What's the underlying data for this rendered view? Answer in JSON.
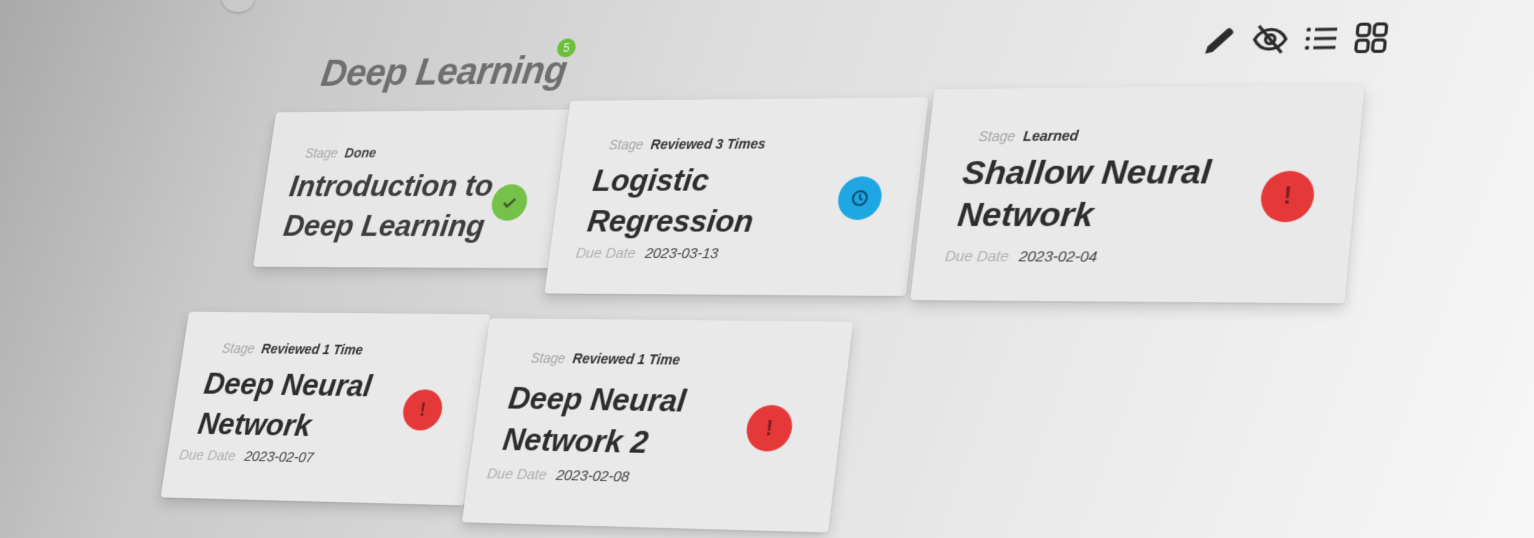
{
  "header": {
    "title": "Deep Learning",
    "count": "5"
  },
  "toolbar": {
    "items": [
      {
        "icon": "pencil-icon"
      },
      {
        "icon": "eye-off-icon"
      },
      {
        "icon": "list-view-icon"
      },
      {
        "icon": "grid-view-icon"
      }
    ]
  },
  "labels": {
    "stage": "Stage",
    "due_date": "Due Date"
  },
  "cards": [
    {
      "title": "Introduction to Deep Learning",
      "stage": "Done",
      "due_date": "",
      "status": "done",
      "status_icon": "check-icon",
      "color": "#6cbf3a"
    },
    {
      "title": "Logistic Regression",
      "stage": "Reviewed 3 Times",
      "due_date": "2023-03-13",
      "status": "review",
      "status_icon": "history-icon",
      "color": "#1ea7e3"
    },
    {
      "title": "Shallow Neural Network",
      "stage": "Learned",
      "due_date": "2023-02-04",
      "status": "overdue",
      "status_icon": "exclamation-icon",
      "color": "#e53939"
    },
    {
      "title": "Deep Neural Network",
      "stage": "Reviewed 1 Time",
      "due_date": "2023-02-07",
      "status": "overdue",
      "status_icon": "exclamation-icon",
      "color": "#e53939"
    },
    {
      "title": "Deep Neural Network 2",
      "stage": "Reviewed 1 Time",
      "due_date": "2023-02-08",
      "status": "overdue",
      "status_icon": "exclamation-icon",
      "color": "#e53939"
    }
  ]
}
